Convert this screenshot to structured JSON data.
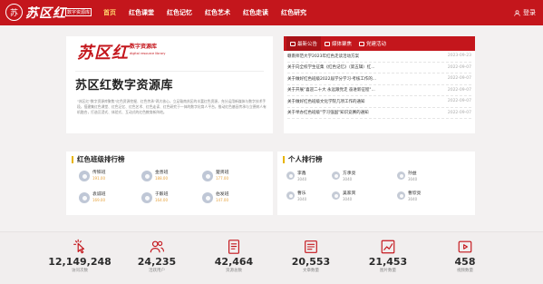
{
  "brand": {
    "logo_mark": "苏",
    "logo_text": "苏区红",
    "logo_sub": "数字资源库"
  },
  "nav": {
    "items": [
      "首页",
      "红色课堂",
      "红色记忆",
      "红色艺术",
      "红色走读",
      "红色研究"
    ],
    "active_index": 0
  },
  "header": {
    "login_label": "登录",
    "login_icon": "user-icon"
  },
  "banner": {
    "brand_big": "苏区红",
    "brand_small": "数字资源库",
    "brand_en": "digital resource library",
    "title": "苏区红数字资源库",
    "description": "\"苏区红\"数字资源库聚焦\"红色资源挖掘、红色传承\"两大核心，立足赣南苏区的丰富红色资源，充分运用新媒体与数字技术手段，搭建集红色课堂、红色记忆、红色艺术、红色走读、红色研究于一体的数字化育人平台，推动红色基因传承与立德树人有机融合，打造沉浸式、体验式、互动式的红色教育新阵地。"
  },
  "notice": {
    "tabs": [
      {
        "label": "最新公告",
        "icon": "notice-icon"
      },
      {
        "label": "媒体聚焦",
        "icon": "media-icon"
      },
      {
        "label": "党建活动",
        "icon": "party-icon"
      }
    ],
    "items": [
      {
        "title": "赣南师范大学2023年红色走读活动方案",
        "date": "2023-09-23"
      },
      {
        "title": "关于向全校学生征集《红色记忆》（第五辑）红...",
        "date": "2022-09-07"
      },
      {
        "title": "关于做好红色班级2022届学分学习·考核工作的...",
        "date": "2022-09-07"
      },
      {
        "title": "关于开展\"喜迎二十大 永远跟党走 奋进新征程\"...",
        "date": "2022-09-07"
      },
      {
        "title": "关于做好红色班级文化学院几项工作的通知",
        "date": "2022-09-07"
      },
      {
        "title": "关于举办红色班级\"学习强国\"知识竞赛的通知",
        "date": "2022-09-07"
      }
    ]
  },
  "class_rank": {
    "title": "红色班级排行榜",
    "items": [
      {
        "name": "传铁班",
        "score": "191.00"
      },
      {
        "name": "金善班",
        "score": "188.00"
      },
      {
        "name": "楚贤班",
        "score": "177.00"
      },
      {
        "name": "袁诚班",
        "score": "169.00"
      },
      {
        "name": "于毅班",
        "score": "164.00"
      },
      {
        "name": "伯发班",
        "score": "147.00"
      }
    ]
  },
  "user_rank": {
    "title": "个人排行榜",
    "items": [
      {
        "name": "李鑫",
        "score": "3040"
      },
      {
        "name": "方承亮",
        "score": "3040"
      },
      {
        "name": "孙益",
        "score": "3040"
      },
      {
        "name": "曹乐",
        "score": "3040"
      },
      {
        "name": "吴家宾",
        "score": "3040"
      },
      {
        "name": "曹欣亮",
        "score": "3040"
      }
    ]
  },
  "stats": [
    {
      "value": "12,149,248",
      "label": "访问次数",
      "icon": "click-icon"
    },
    {
      "value": "24,235",
      "label": "活跃用户",
      "icon": "users-icon"
    },
    {
      "value": "42,464",
      "label": "资源总数",
      "icon": "document-icon"
    },
    {
      "value": "20,553",
      "label": "文章数量",
      "icon": "article-icon"
    },
    {
      "value": "21,453",
      "label": "图片数量",
      "icon": "chart-icon"
    },
    {
      "value": "458",
      "label": "视频数量",
      "icon": "video-icon"
    }
  ],
  "colors": {
    "primary_red": "#c4161c",
    "nav_active": "#ffd36b",
    "rank_accent": "#e8b400",
    "score_orange": "#e6a23c"
  }
}
